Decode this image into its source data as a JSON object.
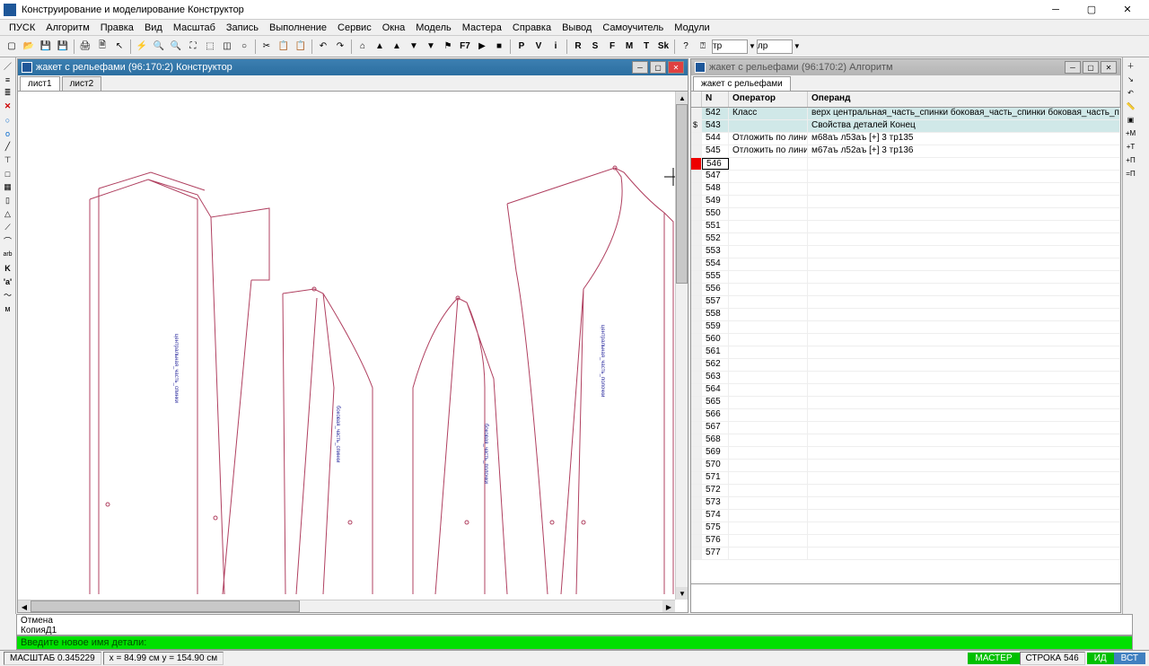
{
  "app": {
    "title": "Конструирование и моделирование  Конструктор"
  },
  "menu": [
    "ПУСК",
    "Алгоритм",
    "Правка",
    "Вид",
    "Масштаб",
    "Запись",
    "Выполнение",
    "Сервис",
    "Окна",
    "Модель",
    "Мастера",
    "Справка",
    "Вывод",
    "Самоучитель",
    "Модули"
  ],
  "toolbar": {
    "input1": "тр",
    "input2": "лр",
    "f7": "F7",
    "p": "P",
    "v": "V",
    "i": "i",
    "r": "R",
    "s": "S",
    "f": "F",
    "m": "M",
    "t": "T",
    "sk": "Sk"
  },
  "panelLeft": {
    "title": "жакет с рельефами (96:170:2) Конструктор",
    "tabs": [
      "лист1",
      "лист2"
    ]
  },
  "panelRight": {
    "title": "жакет с рельефами (96:170:2) Алгоритм",
    "tab": "жакет с рельефами",
    "headers": {
      "n": "N",
      "op": "Оператор",
      "opd": "Операнд"
    },
    "rows": [
      {
        "n": "542",
        "op": "Класс",
        "opd": "верх центральная_часть_спинки боковая_часть_спинки боковая_часть_полочки центральная_часть_полочки верхняя_часть_рукава нижняя_часть_рукава",
        "hl": true
      },
      {
        "n": "543",
        "op": "",
        "opd": "Свойства деталей Конец",
        "hl": true,
        "dollar": true
      },
      {
        "n": "544",
        "op": "Отложить по линии",
        "opd": "м68аъ л53аъ [+] 3 тр135"
      },
      {
        "n": "545",
        "op": "Отложить по линии",
        "opd": "м67аъ л52аъ [+] 3 тр136"
      },
      {
        "n": "546",
        "op": "",
        "opd": "",
        "red": true,
        "sel": true
      },
      {
        "n": "547"
      },
      {
        "n": "548"
      },
      {
        "n": "549"
      },
      {
        "n": "550"
      },
      {
        "n": "551"
      },
      {
        "n": "552"
      },
      {
        "n": "553"
      },
      {
        "n": "554"
      },
      {
        "n": "555"
      },
      {
        "n": "556"
      },
      {
        "n": "557"
      },
      {
        "n": "558"
      },
      {
        "n": "559"
      },
      {
        "n": "560"
      },
      {
        "n": "561"
      },
      {
        "n": "562"
      },
      {
        "n": "563"
      },
      {
        "n": "564"
      },
      {
        "n": "565"
      },
      {
        "n": "566"
      },
      {
        "n": "567"
      },
      {
        "n": "568"
      },
      {
        "n": "569"
      },
      {
        "n": "570"
      },
      {
        "n": "571"
      },
      {
        "n": "572"
      },
      {
        "n": "573"
      },
      {
        "n": "574"
      },
      {
        "n": "575"
      },
      {
        "n": "576"
      },
      {
        "n": "577"
      }
    ]
  },
  "console": {
    "line1": "Отмена",
    "line2": "КопияД1"
  },
  "prompt": "Введите новое имя детали:",
  "status": {
    "scale": "МАСШТАБ 0.345229",
    "coords": "x = 84.99 см    y = 154.90 см",
    "master": "МАСТЕР",
    "row": "СТРОКА 546",
    "id": "ИД",
    "vst": "ВСТ"
  }
}
